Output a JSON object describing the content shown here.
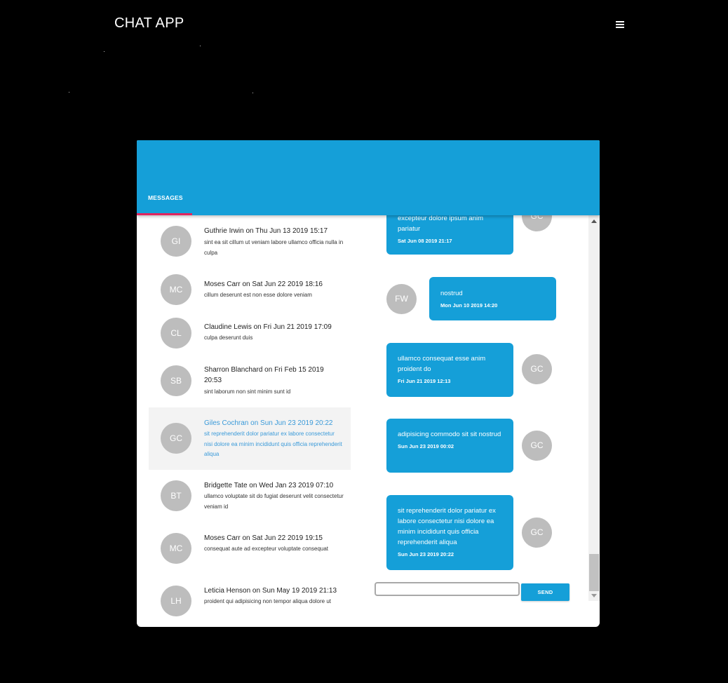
{
  "app": {
    "title": "CHAT APP"
  },
  "tabs": {
    "messages": "MESSAGES"
  },
  "conversations": [
    {
      "initials": "GI",
      "title": "Guthrie Irwin on Thu Jun 13 2019 15:17",
      "snippet": "sint ea sit cillum ut veniam labore ullamco officia nulla in culpa"
    },
    {
      "initials": "MC",
      "title": "Moses Carr on Sat Jun 22 2019 18:16",
      "snippet": "cillum deserunt est non esse dolore veniam"
    },
    {
      "initials": "CL",
      "title": "Claudine Lewis on Fri Jun 21 2019 17:09",
      "snippet": "culpa deserunt duis"
    },
    {
      "initials": "SB",
      "title": "Sharron Blanchard on Fri Feb 15 2019 20:53",
      "snippet": "sint laborum non sint minim sunt id"
    },
    {
      "initials": "GC",
      "title": "Giles Cochran on Sun Jun 23 2019 20:22",
      "snippet": "sit reprehenderit dolor pariatur ex labore consectetur nisi dolore ea minim incididunt quis officia reprehenderit aliqua"
    },
    {
      "initials": "BT",
      "title": "Bridgette Tate on Wed Jan 23 2019 07:10",
      "snippet": "ullamco voluptate sit do fugiat deserunt velit consectetur veniam id"
    },
    {
      "initials": "MC",
      "title": "Moses Carr on Sat Jun 22 2019 19:15",
      "snippet": "consequat aute ad excepteur voluptate consequat"
    },
    {
      "initials": "LH",
      "title": "Leticia Henson on Sun May 19 2019 21:13",
      "snippet": "proident qui adipisicing non tempor aliqua dolore ut"
    }
  ],
  "messages": [
    {
      "initials": "GC",
      "text": "excepteur dolore ipsum anim pariatur",
      "time": "Sat Jun 08 2019 21:17"
    },
    {
      "initials": "FW",
      "text": "nostrud",
      "time": "Mon Jun 10 2019 14:20"
    },
    {
      "initials": "GC",
      "text": "ullamco consequat esse anim proident do",
      "time": "Fri Jun 21 2019 12:13"
    },
    {
      "initials": "GC",
      "text": "adipisicing commodo sit sit nostrud",
      "time": "Sun Jun 23 2019 00:02"
    },
    {
      "initials": "GC",
      "text": "sit reprehenderit dolor pariatur ex labore consectetur nisi dolore ea minim incididunt quis officia reprehenderit aliqua",
      "time": "Sun Jun 23 2019 20:22"
    }
  ],
  "composer": {
    "input_value": "",
    "send_label": "SEND"
  },
  "colors": {
    "accent": "#159fd8",
    "tab_indicator": "#e0245e",
    "avatar": "#bdbdbd",
    "active_text": "#3a9ad9"
  },
  "icons": {
    "menu": "hamburger-menu-icon"
  }
}
